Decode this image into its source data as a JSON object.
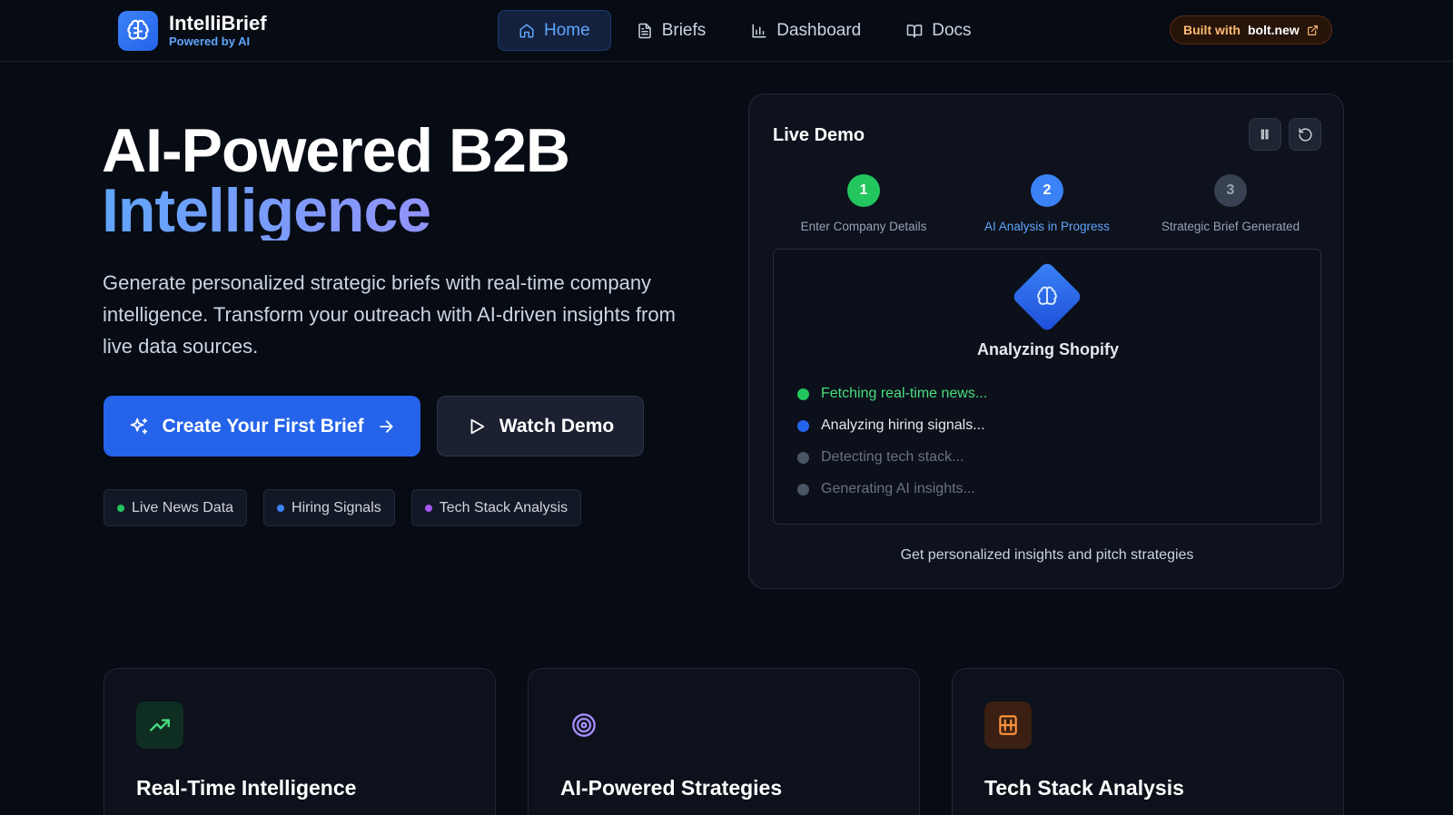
{
  "brand": {
    "title": "IntelliBrief",
    "subtitle": "Powered by AI"
  },
  "nav": {
    "items": [
      {
        "label": "Home",
        "icon": "home-icon",
        "active": true
      },
      {
        "label": "Briefs",
        "icon": "document-icon",
        "active": false
      },
      {
        "label": "Dashboard",
        "icon": "bar-chart-icon",
        "active": false
      },
      {
        "label": "Docs",
        "icon": "book-icon",
        "active": false
      }
    ]
  },
  "badge": {
    "prefix": "Built with",
    "name": "bolt.new",
    "icon": "external-link-icon"
  },
  "hero": {
    "title_line1": "AI-Powered B2B",
    "title_line2": "Intelligence",
    "description": "Generate personalized strategic briefs with real-time company intelligence. Transform your outreach with AI-driven insights from live data sources.",
    "primary_cta": "Create Your First Brief",
    "secondary_cta": "Watch Demo",
    "tags": [
      {
        "label": "Live News Data",
        "color": "#22c55e"
      },
      {
        "label": "Hiring Signals",
        "color": "#3b82f6"
      },
      {
        "label": "Tech Stack Analysis",
        "color": "#a855f7"
      }
    ]
  },
  "demo": {
    "title": "Live Demo",
    "steps": [
      {
        "num": "1",
        "label": "Enter Company Details",
        "color": "#22c55e"
      },
      {
        "num": "2",
        "label": "AI Analysis in Progress",
        "color": "#3b82f6"
      },
      {
        "num": "3",
        "label": "Strategic Brief Generated",
        "color": "#374151"
      }
    ],
    "analysis_title": "Analyzing Shopify",
    "tasks": [
      {
        "label": "Fetching real-time news...",
        "dot": "#22c55e",
        "text_color": "#4ade80"
      },
      {
        "label": "Analyzing hiring signals...",
        "dot": "#2563eb",
        "text_color": "#e5e7eb"
      },
      {
        "label": "Detecting tech stack...",
        "dot": "#4b5563",
        "text_color": "#6b7280"
      },
      {
        "label": "Generating AI insights...",
        "dot": "#4b5563",
        "text_color": "#6b7280"
      }
    ],
    "footer": "Get personalized insights and pitch strategies"
  },
  "features": [
    {
      "title": "Real-Time Intelligence",
      "icon": "trending-up-icon",
      "icon_bg": "#0f2e22",
      "icon_color": "#4ade80"
    },
    {
      "title": "AI-Powered Strategies",
      "icon": "target-icon",
      "icon_bg": "transparent",
      "icon_color": "#a78bfa"
    },
    {
      "title": "Tech Stack Analysis",
      "icon": "server-icon",
      "icon_bg": "#3a1f12",
      "icon_color": "#fb923c"
    }
  ]
}
